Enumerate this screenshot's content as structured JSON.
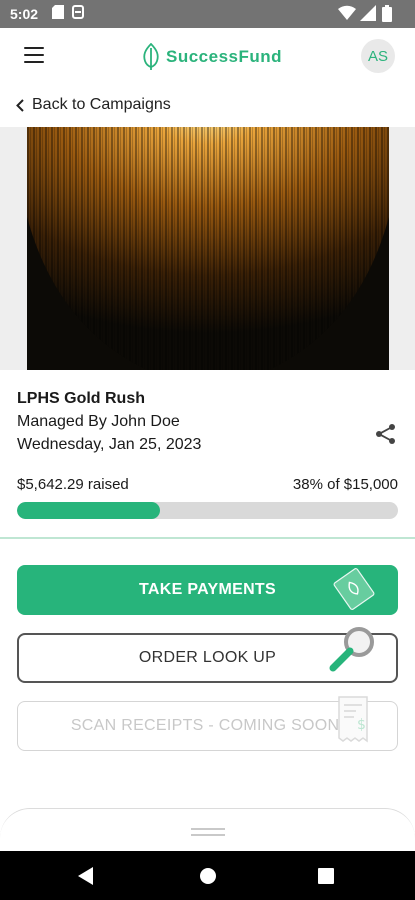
{
  "status_bar": {
    "time": "5:02"
  },
  "app_bar": {
    "brand": "SuccessFund",
    "avatar_initials": "AS"
  },
  "nav": {
    "back_label": "Back to Campaigns"
  },
  "campaign": {
    "title": "LPHS Gold Rush",
    "managed_by": "Managed By John Doe",
    "date": "Wednesday, Jan 25, 2023",
    "raised_label": "$5,642.29 raised",
    "goal_label": "38% of $15,000",
    "progress_fraction": 0.376
  },
  "actions": {
    "take_payments": "TAKE PAYMENTS",
    "order_lookup": "ORDER LOOK UP",
    "scan_receipts": "SCAN RECEIPTS - COMING SOON!"
  },
  "colors": {
    "accent": "#27b47b"
  }
}
